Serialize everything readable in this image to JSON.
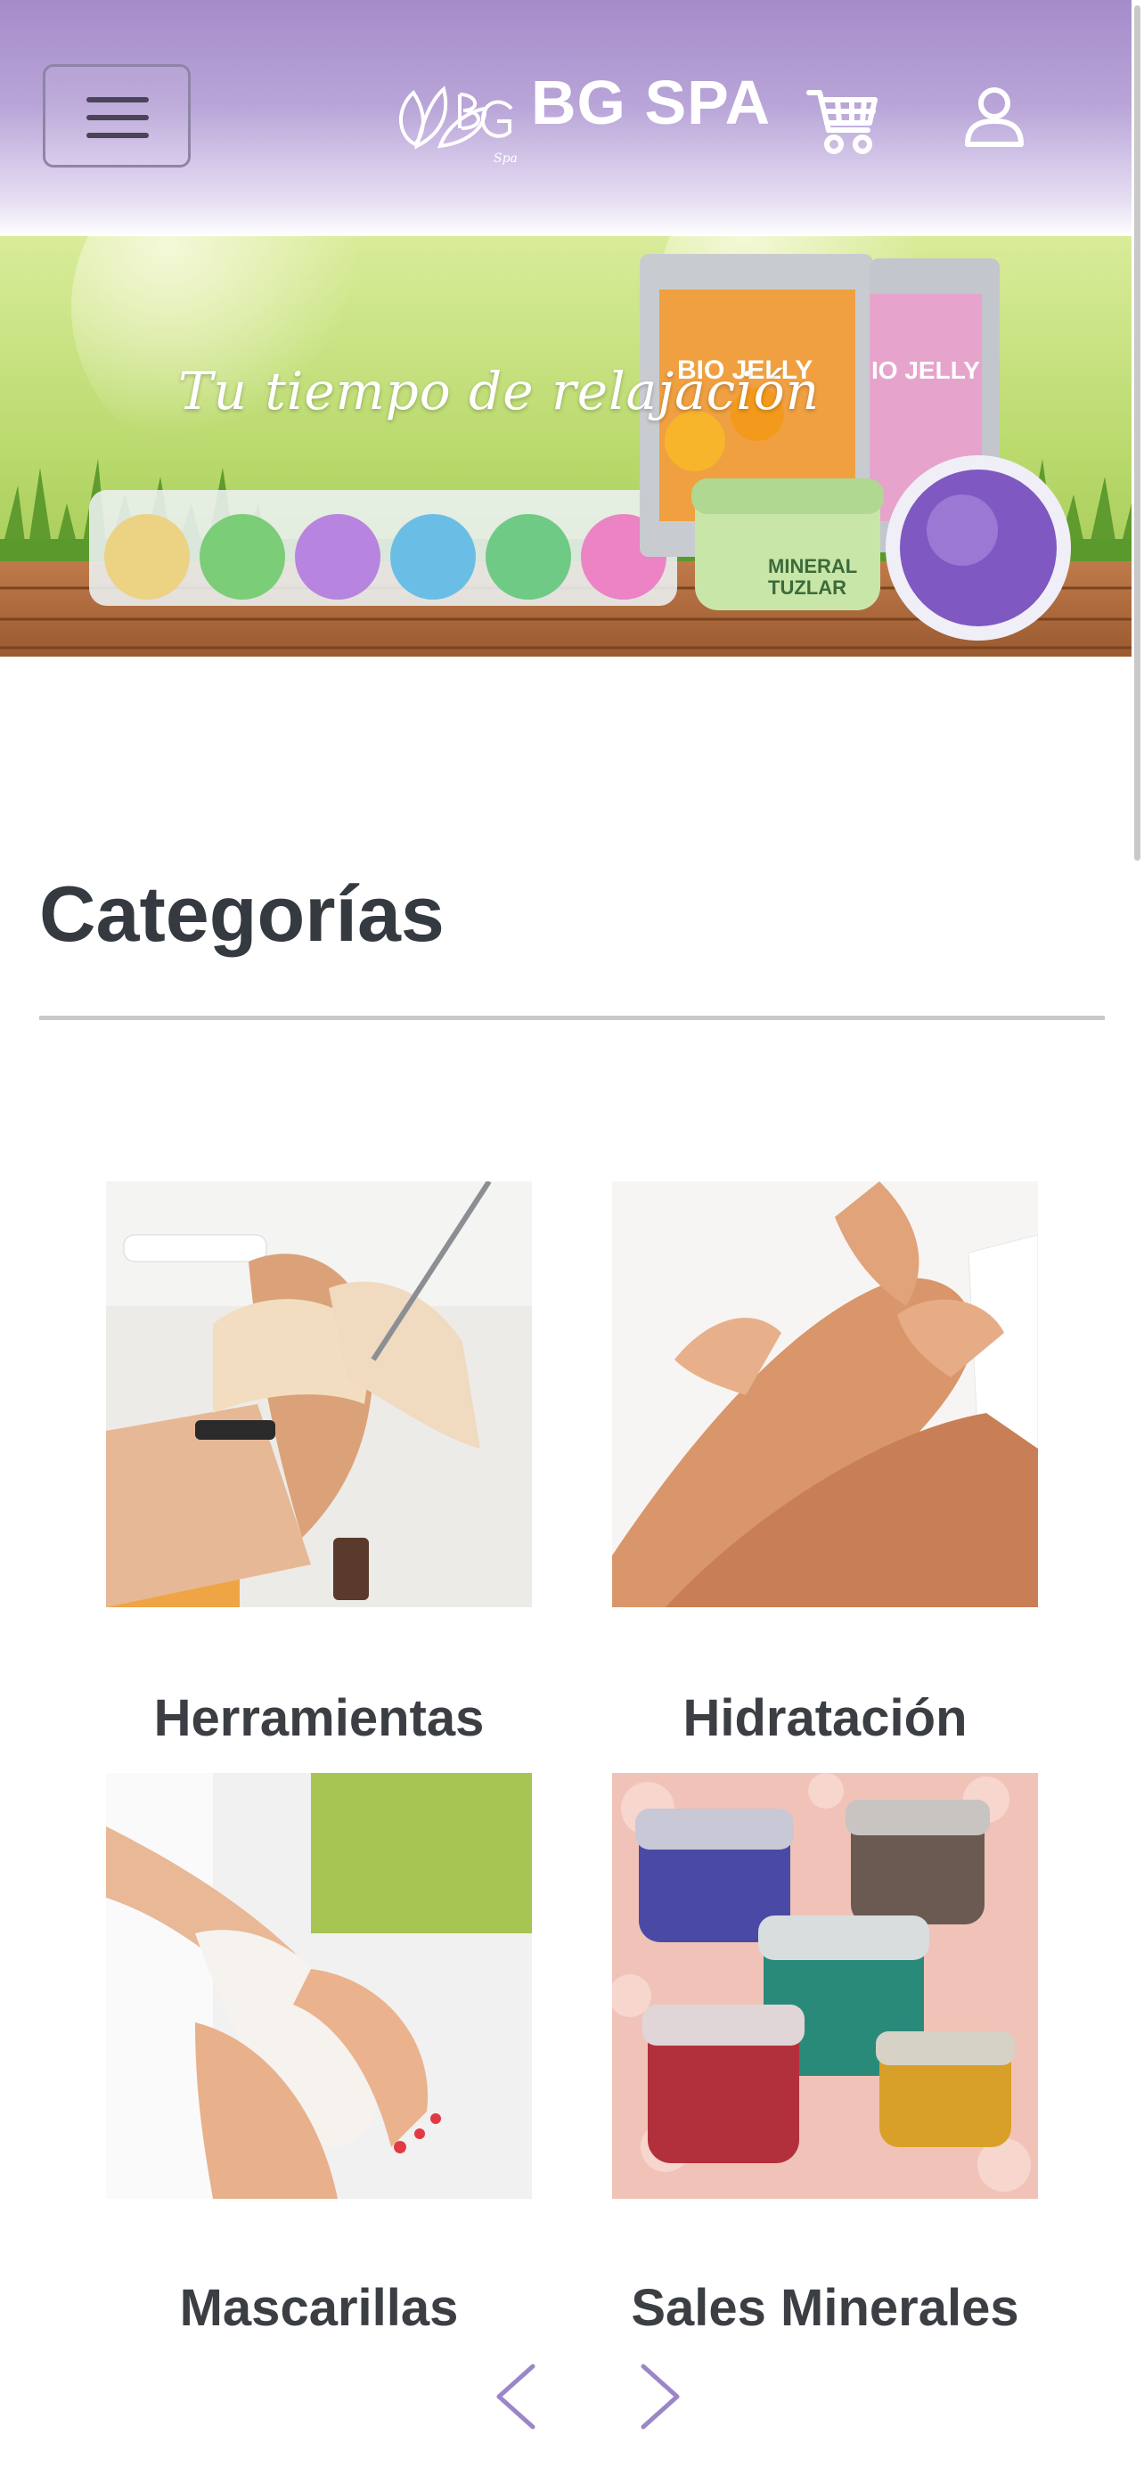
{
  "header": {
    "brand": "BG SPA",
    "logo_icon": "bg-spa-lotus-logo",
    "cart_icon": "shopping-cart-icon",
    "user_icon": "user-account-icon",
    "menu_icon": "hamburger-menu-icon"
  },
  "banner": {
    "slogan": "Tu tiempo de relajación",
    "products": [
      "BIO JELLY Naranja",
      "BIO JELLY Lavanda",
      "MINERAL TUZLAR",
      "MINERAL TUZLAR"
    ]
  },
  "categories": {
    "title": "Categorías",
    "items": [
      {
        "label": "Herramientas",
        "image": "pedicure-tools-photo"
      },
      {
        "label": "Hidratación",
        "image": "moisturized-legs-photo"
      },
      {
        "label": "Mascarillas",
        "image": "foot-mask-photo"
      },
      {
        "label": "Sales Minerales",
        "image": "mineral-salts-jars-photo"
      }
    ]
  },
  "carousel": {
    "prev_icon": "chevron-left-icon",
    "next_icon": "chevron-right-icon"
  },
  "colors": {
    "header_purple": "#a58cca",
    "arrow_purple": "#9b86c8",
    "title_text": "#343a40"
  }
}
